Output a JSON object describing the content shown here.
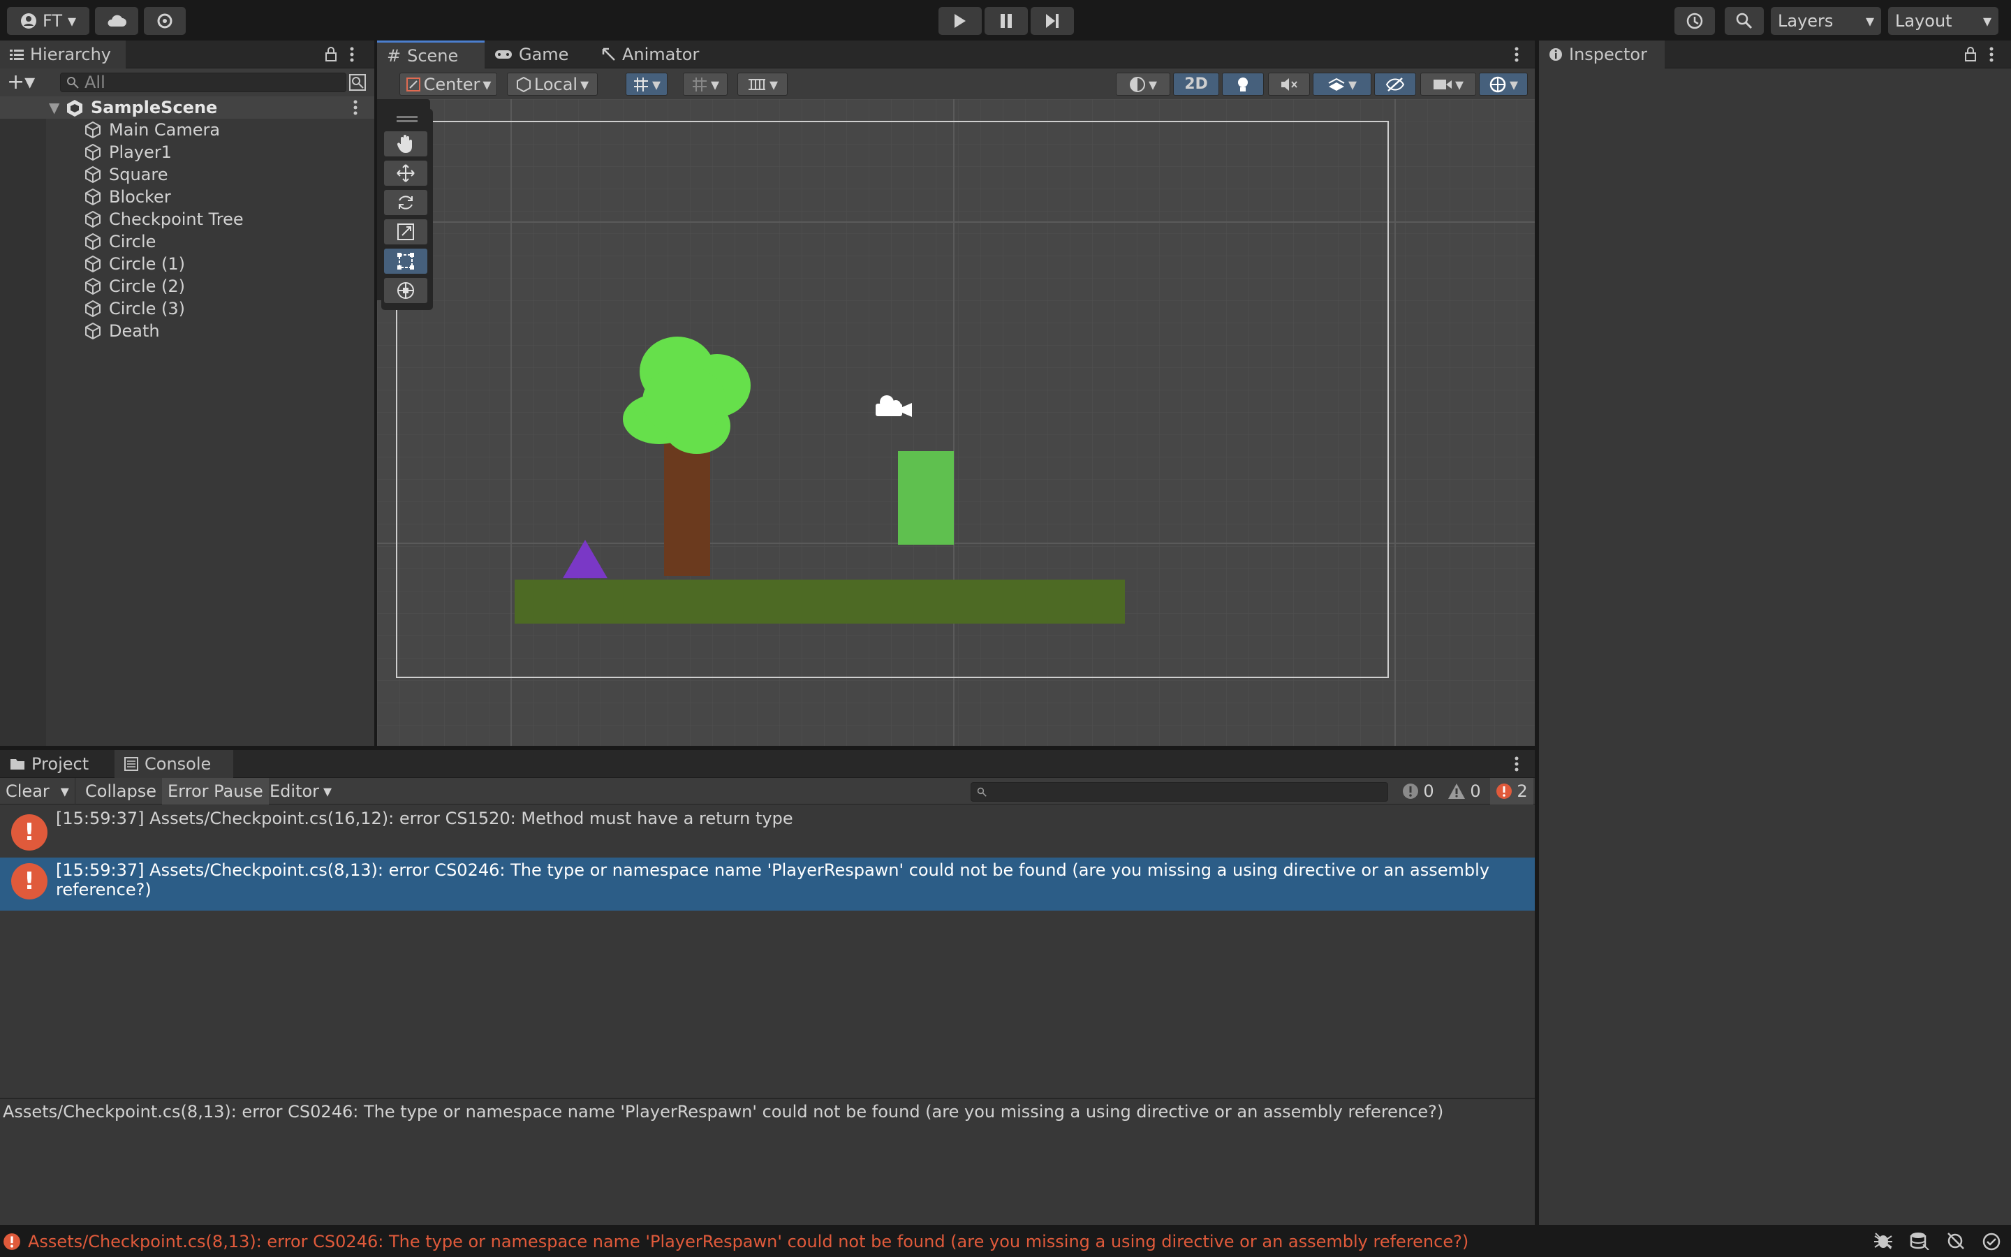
{
  "topbar": {
    "account_label": "FT",
    "layers_label": "Layers",
    "layout_label": "Layout"
  },
  "hierarchy": {
    "tab_label": "Hierarchy",
    "search_placeholder": "All",
    "scene_name": "SampleScene",
    "items": [
      "Main Camera",
      "Player1",
      "Square",
      "Blocker",
      "Checkpoint Tree",
      "Circle",
      "Circle (1)",
      "Circle (2)",
      "Circle (3)",
      "Death"
    ]
  },
  "scene_view": {
    "tabs": [
      "Scene",
      "Game",
      "Animator"
    ],
    "pivot_label": "Center",
    "space_label": "Local",
    "mode_2d_label": "2D"
  },
  "inspector": {
    "tab_label": "Inspector"
  },
  "console": {
    "tabs": [
      "Project",
      "Console"
    ],
    "clear_label": "Clear",
    "collapse_label": "Collapse",
    "error_pause_label": "Error Pause",
    "editor_label": "Editor",
    "info_count": "0",
    "warning_count": "0",
    "error_count": "2",
    "entries": [
      "[15:59:37] Assets/Checkpoint.cs(16,12): error CS1520: Method must have a return type",
      "[15:59:37] Assets/Checkpoint.cs(8,13): error CS0246: The type or namespace name 'PlayerRespawn' could not be found (are you missing a using directive or an assembly reference?)"
    ],
    "detail": "Assets/Checkpoint.cs(8,13): error CS0246: The type or namespace name 'PlayerRespawn' could not be found (are you missing a using directive or an assembly reference?)"
  },
  "statusbar": {
    "message": "Assets/Checkpoint.cs(8,13): error CS0246: The type or namespace name 'PlayerRespawn' could not be found (are you missing a using directive or an assembly reference?)"
  },
  "colors": {
    "accent": "#4c7fcf",
    "selection": "#2c5d87",
    "error": "#e05a3b",
    "tree_foliage": "#66e04b",
    "tree_trunk": "#6b3a1e",
    "ground": "#4d6a24",
    "player": "#5fc04f",
    "triangle": "#7a38c6"
  }
}
